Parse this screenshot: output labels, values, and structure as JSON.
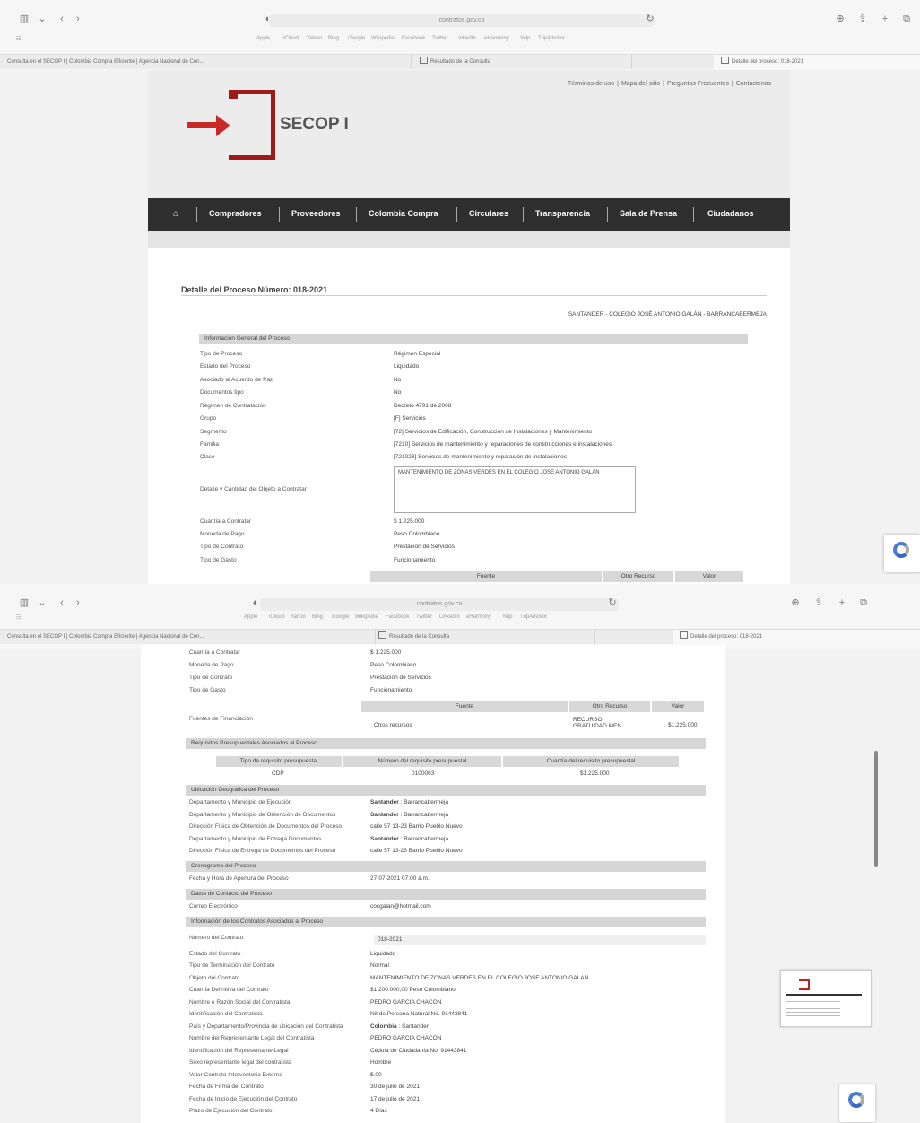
{
  "browser": {
    "address": "contratos.gov.co",
    "favorites": [
      "Apple",
      "iCloud",
      "Yahoo",
      "Bing",
      "Google",
      "Wikipedia",
      "Facebook",
      "Twitter",
      "LinkedIn",
      "eHarmony",
      "Yelp",
      "TripAdvisor"
    ],
    "tabs": [
      "Consulta en el SECOP I | Colombia Compra Eficiente | Agencia Nacional de Con...",
      "Resultado de la Consulta",
      "Detalle del proceso: 018-2021"
    ]
  },
  "site": {
    "logo_text": "SECOP I",
    "top_links": [
      "Términos de uso",
      "Mapa del sitio",
      "Preguntas Frecuentes",
      "Contáctenos"
    ],
    "nav": [
      "Compradores",
      "Proveedores",
      "Colombia Compra",
      "Circulares",
      "Transparencia",
      "Sala de Prensa",
      "Ciudadanos"
    ]
  },
  "process": {
    "title": "Detalle del Proceso Número: 018-2021",
    "entity": "SANTANDER - COLEGIO JOSÉ ANTONIO GALÁN - BARRANCABERMEJA"
  },
  "general": {
    "header": "Información General del Proceso",
    "rows": [
      {
        "label": "Tipo de Proceso",
        "value": "Régimen Especial"
      },
      {
        "label": "Estado del Proceso",
        "value": "Liquidado"
      },
      {
        "label": "Asociado al Acuerdo de Paz",
        "value": "No"
      },
      {
        "label": "Documentos tipo",
        "value": "No"
      },
      {
        "label": "Régimen de Contratación",
        "value": "Decreto 4791 de 2008"
      },
      {
        "label": "Grupo",
        "value": "[F] Servicios"
      },
      {
        "label": "Segmento",
        "value": "[72] Servicios de Edificación, Construcción de Instalaciones y Mantenimiento"
      },
      {
        "label": "Familia",
        "value": "[7210] Servicios de mantenimiento y reparaciones de construcciones e instalaciones"
      },
      {
        "label": "Clase",
        "value": "[721028] Servicios de mantenimiento y reparación de instalaciones"
      }
    ],
    "objeto_label": "Detalle y Cantidad del Objeto a Contratar",
    "objeto_value": "MANTENIMIENTO DE ZONAS VERDES EN EL COLEGIO JOSE ANTONIO GALAN",
    "rows2": [
      {
        "label": "Cuantía a Contratar",
        "value": "$ 1.225.000"
      },
      {
        "label": "Moneda de Pago",
        "value": "Peso Colombiano"
      },
      {
        "label": "Tipo de Contrato",
        "value": "Prestación de Servicios"
      },
      {
        "label": "Tipo de Gasto",
        "value": "Funcionamiento"
      }
    ],
    "fuentes_label": "Fuentes de Financiación",
    "fuentes_headers": [
      "Fuente",
      "Otro Recurso",
      "Valor"
    ],
    "fuentes_row": [
      "Otros recursos",
      "RECURSO GRATUIDAD MEN",
      "$1.225.000"
    ]
  },
  "presupuestales": {
    "header": "Requisitos Presupuestales Asociados al Proceso",
    "headers": [
      "Tipo de requisito presupuestal",
      "Número del requisito presupuestal",
      "Cuantía del requisito presupuestal"
    ],
    "row": [
      "CDP",
      "0100063",
      "$1.225.000"
    ]
  },
  "ubicacion": {
    "header": "Ubicación Geográfica del Proceso",
    "rows": [
      {
        "label": "Departamento y Municipio de Ejecución",
        "bold": "Santander",
        "value": " : Barrancabermeja"
      },
      {
        "label": "Departamento y Municipio de Obtención de Documentos",
        "bold": "Santander",
        "value": " : Barrancabermeja"
      },
      {
        "label": "Dirección Física de Obtención de Documentos del Proceso",
        "bold": "",
        "value": "calle 57 13-23 Barrio Pueblo Nuevo"
      },
      {
        "label": "Departamento y Municipio de Entrega Documentos",
        "bold": "Santander",
        "value": " : Barrancabermeja"
      },
      {
        "label": "Dirección Física de Entrega de Documentos del Proceso",
        "bold": "",
        "value": "calle 57 13-23 Barrio Pueblo Nuevo"
      }
    ]
  },
  "cronograma": {
    "header": "Cronograma del Proceso",
    "rows": [
      {
        "label": "Fecha y Hora de Apertura del Proceso",
        "value": "27-07-2021 07:00 a.m."
      }
    ]
  },
  "contacto": {
    "header": "Datos de Contacto del Proceso",
    "rows": [
      {
        "label": "Correo Electrónico",
        "value": "cocgalan@hotmail.com"
      }
    ]
  },
  "contratos": {
    "header": "Información de los Contratos Asociados al Proceso",
    "numero_label": "Número del Contrato",
    "numero_value": "018-2021",
    "rows": [
      {
        "label": "Estado del Contrato",
        "bold": "",
        "value": "Liquidado"
      },
      {
        "label": "Tipo de Terminación del Contrato",
        "bold": "",
        "value": "Normal"
      },
      {
        "label": "Objeto del Contrato",
        "bold": "",
        "value": "MANTENIMIENTO DE ZONAS VERDES EN EL COLEGIO JOSE ANTONIO GALAN"
      },
      {
        "label": "Cuantía Definitiva del Contrato",
        "bold": "",
        "value": "$1.200.000,00 Peso Colombiano"
      },
      {
        "label": "Nombre o Razón Social del Contratista",
        "bold": "",
        "value": "PEDRO GARCIA CHACON"
      },
      {
        "label": "Identificación del Contratista",
        "bold": "",
        "value": "Nit de Persona Natural No. 91443841"
      },
      {
        "label": "País y Departamento/Provincia de ubicación del Contratista",
        "bold": "Colombia",
        "value": " : Santander"
      },
      {
        "label": "Nombre del Representante Legal del Contratista",
        "bold": "",
        "value": "PEDRO GARCIA CHACON"
      },
      {
        "label": "Identificación del Representante Legal",
        "bold": "",
        "value": "Cédula de Ciudadanía No. 91443841"
      },
      {
        "label": "Sexo representante legal del contratista",
        "bold": "",
        "value": "Hombre"
      },
      {
        "label": "Valor Contrato Interventoría Externa",
        "bold": "",
        "value": "$.00"
      },
      {
        "label": "Fecha de Firma del Contrato",
        "bold": "",
        "value": "30 de julio de 2021"
      },
      {
        "label": "Fecha de Inicio de Ejecución del Contrato",
        "bold": "",
        "value": "17 de julio de 2021"
      },
      {
        "label": "Plazo de Ejecución del Contrato",
        "bold": "",
        "value": "4 Días"
      }
    ]
  }
}
